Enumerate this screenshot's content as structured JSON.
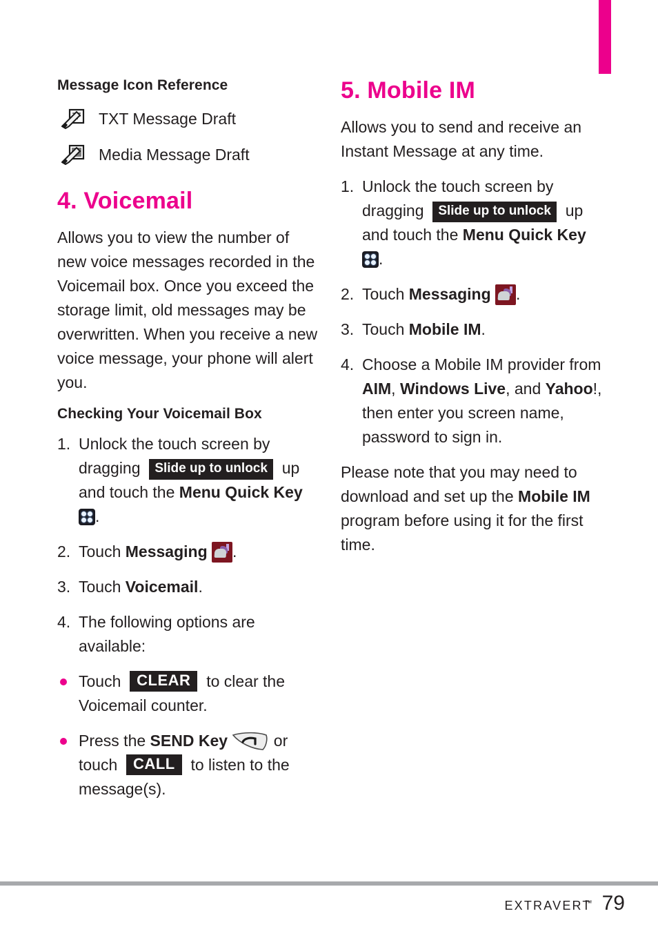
{
  "page": {
    "number": "79",
    "brand": "Extravert",
    "trademark": "™",
    "accent_color": "#ec008c",
    "text_color": "#231f20",
    "rule_color": "#a7a9ac"
  },
  "left_column": {
    "icon_reference": {
      "heading": "Message Icon Reference",
      "items": [
        {
          "icon": "txt-message-draft-icon",
          "label": "TXT Message Draft"
        },
        {
          "icon": "media-message-draft-icon",
          "label": "Media Message Draft"
        }
      ]
    },
    "section": {
      "heading": "4. Voicemail",
      "intro": "Allows you to view the number of new voice messages recorded in the Voicemail box. Once you exceed the storage limit, old messages may be overwritten. When you receive a new voice message, your phone will alert you.",
      "subheading": "Checking Your Voicemail Box",
      "steps": [
        {
          "num": "1.",
          "parts": [
            {
              "t": "text",
              "v": "Unlock the touch screen by dragging "
            },
            {
              "t": "chip",
              "v": "Slide up to unlock"
            },
            {
              "t": "text",
              "v": " up and touch the "
            },
            {
              "t": "bold",
              "v": "Menu Quick Key"
            },
            {
              "t": "icon",
              "v": "menu-quick-key-icon"
            },
            {
              "t": "text",
              "v": "."
            }
          ]
        },
        {
          "num": "2.",
          "parts": [
            {
              "t": "text",
              "v": "Touch "
            },
            {
              "t": "bold",
              "v": "Messaging"
            },
            {
              "t": "icon",
              "v": "messaging-icon"
            },
            {
              "t": "text",
              "v": "."
            }
          ]
        },
        {
          "num": "3.",
          "parts": [
            {
              "t": "text",
              "v": "Touch "
            },
            {
              "t": "bold",
              "v": "Voicemail"
            },
            {
              "t": "text",
              "v": "."
            }
          ]
        },
        {
          "num": "4.",
          "parts": [
            {
              "t": "text",
              "v": "The following options are available:"
            }
          ]
        }
      ],
      "bullets": [
        {
          "parts": [
            {
              "t": "text",
              "v": "Touch "
            },
            {
              "t": "chip-hard",
              "v": "CLEAR"
            },
            {
              "t": "text",
              "v": " to clear the Voicemail counter."
            }
          ]
        },
        {
          "parts": [
            {
              "t": "text",
              "v": "Press the "
            },
            {
              "t": "bold",
              "v": "SEND Key"
            },
            {
              "t": "icon",
              "v": "send-key-icon"
            },
            {
              "t": "text",
              "v": " or touch "
            },
            {
              "t": "chip-hard",
              "v": "CALL"
            },
            {
              "t": "text",
              "v": " to listen to the message(s)."
            }
          ]
        }
      ]
    }
  },
  "right_column": {
    "section": {
      "heading": "5. Mobile IM",
      "intro": "Allows you to send and receive an Instant Message at any time.",
      "steps": [
        {
          "num": "1.",
          "parts": [
            {
              "t": "text",
              "v": "Unlock the touch screen by dragging "
            },
            {
              "t": "chip",
              "v": "Slide up to unlock"
            },
            {
              "t": "text",
              "v": " up and touch the "
            },
            {
              "t": "bold",
              "v": "Menu Quick Key"
            },
            {
              "t": "icon",
              "v": "menu-quick-key-icon"
            },
            {
              "t": "text",
              "v": "."
            }
          ]
        },
        {
          "num": "2.",
          "parts": [
            {
              "t": "text",
              "v": "Touch "
            },
            {
              "t": "bold",
              "v": "Messaging"
            },
            {
              "t": "icon",
              "v": "messaging-icon"
            },
            {
              "t": "text",
              "v": "."
            }
          ]
        },
        {
          "num": "3.",
          "parts": [
            {
              "t": "text",
              "v": "Touch "
            },
            {
              "t": "bold",
              "v": "Mobile IM"
            },
            {
              "t": "text",
              "v": "."
            }
          ]
        },
        {
          "num": "4.",
          "parts": [
            {
              "t": "text",
              "v": "Choose a Mobile IM provider from "
            },
            {
              "t": "bold",
              "v": "AIM"
            },
            {
              "t": "text",
              "v": ", "
            },
            {
              "t": "bold",
              "v": "Windows Live"
            },
            {
              "t": "text",
              "v": ", and "
            },
            {
              "t": "bold",
              "v": "Yahoo"
            },
            {
              "t": "text",
              "v": "!, then enter you screen name, password to sign in."
            }
          ]
        }
      ],
      "note": {
        "parts": [
          {
            "t": "text",
            "v": "Please note that you may need to download and set up the "
          },
          {
            "t": "bold",
            "v": "Mobile IM"
          },
          {
            "t": "text",
            "v": " program before using it for the first time."
          }
        ]
      }
    }
  }
}
